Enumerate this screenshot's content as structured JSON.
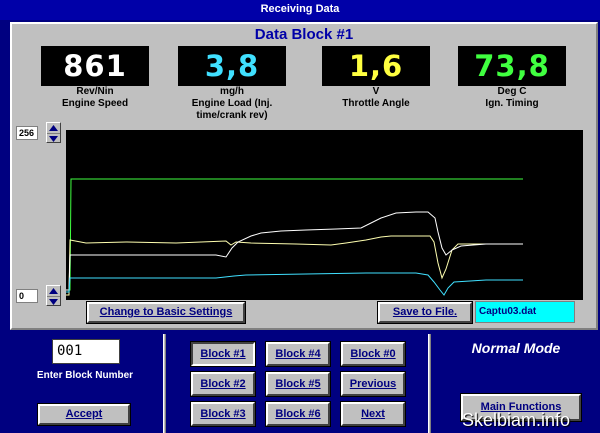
{
  "window": {
    "title": "Receiving Data"
  },
  "block": {
    "title": "Data Block #1"
  },
  "gauges": [
    {
      "value": "861",
      "unit": "Rev/Nin",
      "label": "Engine Speed",
      "color": "#ffffff"
    },
    {
      "value": "3,8",
      "unit": "mg/h",
      "label": "Engine Load (Inj. time/crank rev)",
      "color": "#40e0ff"
    },
    {
      "value": "1,6",
      "unit": "V",
      "label": "Throttle Angle",
      "color": "#ffff40"
    },
    {
      "value": "73,8",
      "unit": "Deg C",
      "label": "Ign. Timing",
      "color": "#40ff40"
    }
  ],
  "scale": {
    "max": "256",
    "min": "0"
  },
  "trace_colors": [
    "#40ff40",
    "#ffffb0",
    "#ffffff",
    "#40e0ff"
  ],
  "buttons": {
    "change_basic": "Change to Basic Settings",
    "save_file": "Save to File.",
    "accept": "Accept",
    "main_functions": "Main Functions",
    "previous": "Previous",
    "next": "Next"
  },
  "save_filename": "Captu03.dat",
  "block_selector": {
    "current_value": "001",
    "label": "Enter Block Number",
    "blocks": [
      "Block #1",
      "Block #2",
      "Block #3",
      "Block #4",
      "Block #5",
      "Block #6",
      "Block #0"
    ]
  },
  "mode": "Normal Mode",
  "watermark": "Skelbiam.info"
}
